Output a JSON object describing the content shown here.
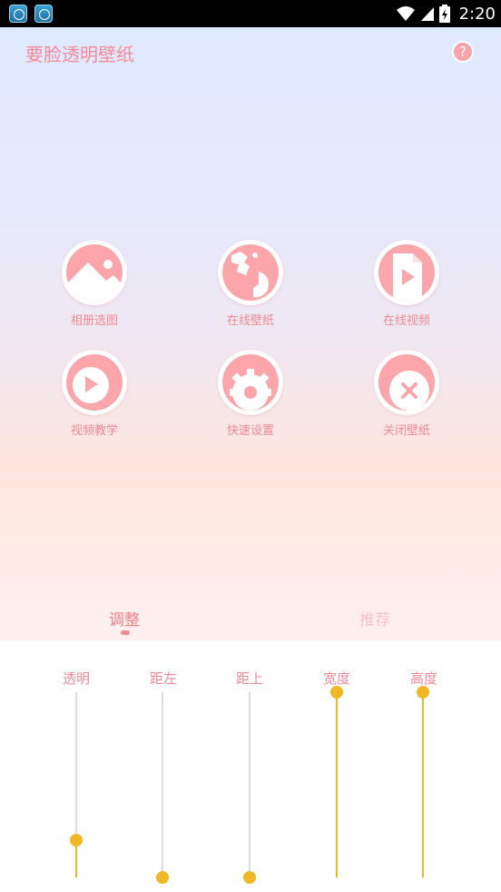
{
  "status_bar": {
    "notif_icons": [
      "app-notification-icon",
      "app-notification-icon"
    ],
    "time": "2:20"
  },
  "app": {
    "title": "要脸透明壁纸",
    "help_glyph": "?"
  },
  "grid": [
    {
      "label": "相册选图",
      "icon": "image-icon"
    },
    {
      "label": "在线壁纸",
      "icon": "globe-icon"
    },
    {
      "label": "在线视频",
      "icon": "video-file-icon"
    },
    {
      "label": "视频教学",
      "icon": "play-icon"
    },
    {
      "label": "快速设置",
      "icon": "gear-icon"
    },
    {
      "label": "关闭壁纸",
      "icon": "close-icon"
    }
  ],
  "tabs": {
    "adjust": "调整",
    "recommend": "推荐",
    "active": "adjust"
  },
  "sliders": [
    {
      "label": "透明",
      "value": 0.2
    },
    {
      "label": "距左",
      "value": 0.0
    },
    {
      "label": "距上",
      "value": 0.0
    },
    {
      "label": "宽度",
      "value": 1.0
    },
    {
      "label": "高度",
      "value": 1.0
    }
  ],
  "colors": {
    "accent_pink": "#f48b96",
    "icon_pink": "#fca6ac",
    "slider_yellow": "#f0b826"
  }
}
